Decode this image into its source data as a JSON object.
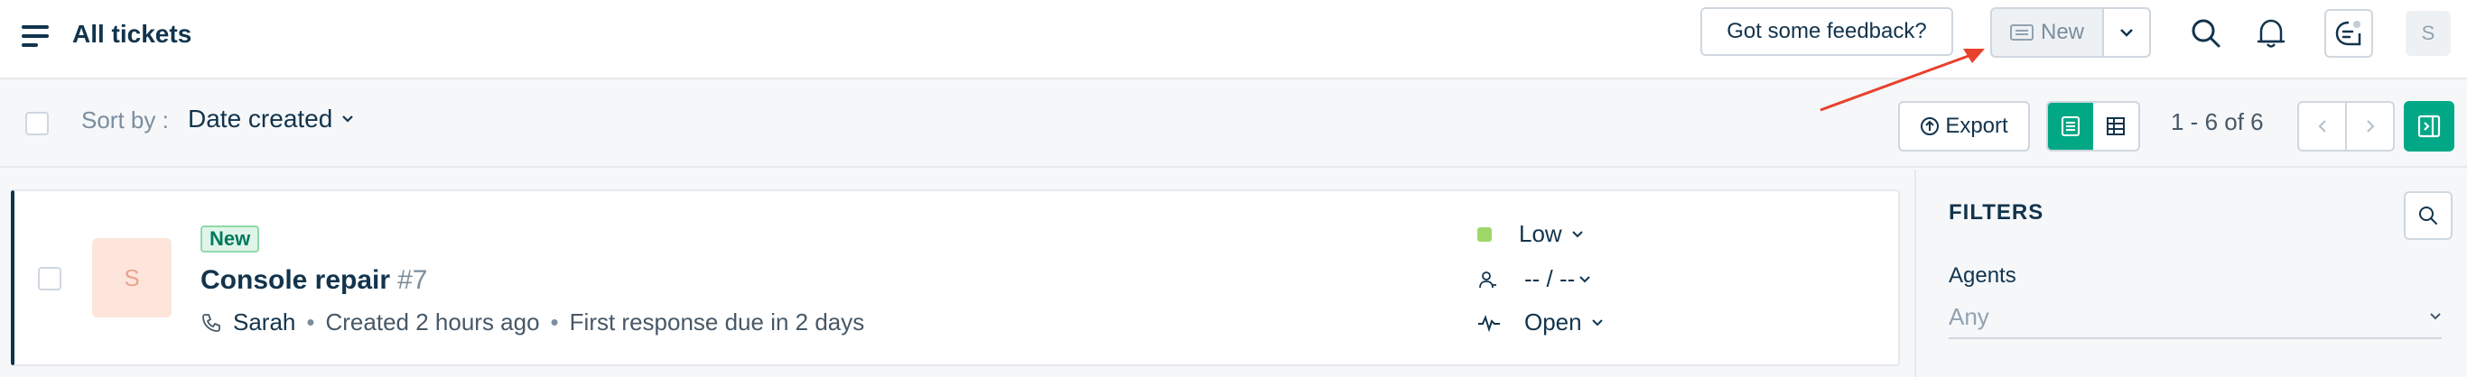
{
  "header": {
    "title": "All tickets",
    "feedback_label": "Got some feedback?",
    "new_label": "New",
    "avatar_initial": "S"
  },
  "toolbar": {
    "sort_label": "Sort by :",
    "sort_value": "Date created",
    "export_label": "Export",
    "pagination": "1 - 6 of 6"
  },
  "tickets": [
    {
      "status": "New",
      "avatar_initial": "S",
      "subject": "Console repair",
      "id": "#7",
      "requester": "Sarah",
      "created": "Created 2 hours ago",
      "due": "First response due in 2 days",
      "priority": "Low",
      "assignee": "-- / --",
      "state": "Open"
    }
  ],
  "filters": {
    "title": "FILTERS",
    "agents_label": "Agents",
    "agents_value": "Any"
  },
  "colors": {
    "accent": "#00a886",
    "annotation": "#e8412c",
    "priority_low": "#a0d76a"
  }
}
